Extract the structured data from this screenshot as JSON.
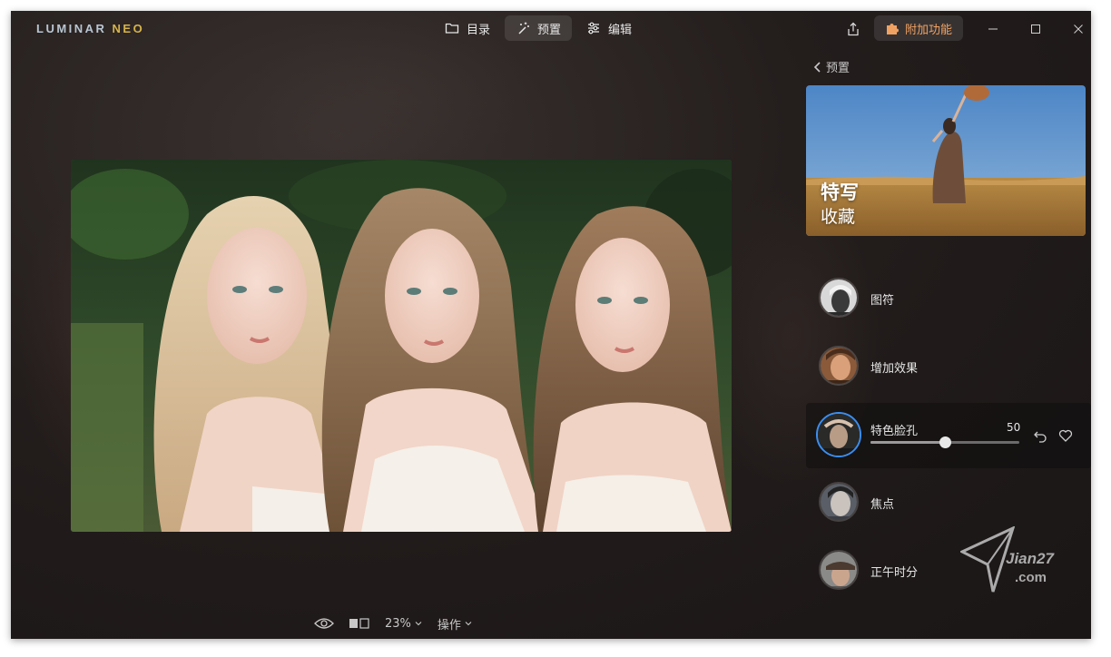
{
  "app": {
    "logo_part1": "LUMINAR ",
    "logo_part2": "NEO"
  },
  "nav": {
    "tabs": [
      {
        "label": "目录",
        "icon": "folder-icon",
        "active": false
      },
      {
        "label": "预置",
        "icon": "magic-wand-icon",
        "active": true
      },
      {
        "label": "编辑",
        "icon": "sliders-icon",
        "active": false
      }
    ]
  },
  "header": {
    "addons_label": "附加功能",
    "addons_color": "#f0a263"
  },
  "panel": {
    "back_label": "预置",
    "collection": {
      "title": "特写",
      "subtitle": "收藏"
    },
    "presets": [
      {
        "name": "图符",
        "selected": false
      },
      {
        "name": "增加效果",
        "selected": false
      },
      {
        "name": "特色脸孔",
        "selected": true,
        "amount": "50",
        "amount_fraction": 0.5
      },
      {
        "name": "焦点",
        "selected": false
      },
      {
        "name": "正午时分",
        "selected": false
      }
    ],
    "accent": "#3b8ef0"
  },
  "bottom": {
    "zoom": "23%",
    "actions": "操作"
  },
  "watermark": {
    "text": "Jian27",
    "sub": ".com"
  }
}
